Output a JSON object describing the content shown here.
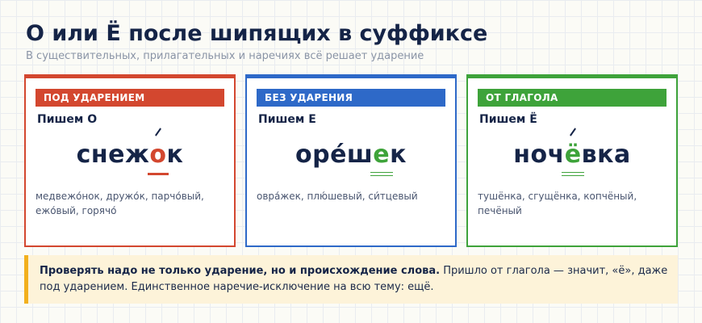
{
  "header": {
    "title": "О или Ё после шипящих в суффиксе",
    "subtitle": "В существительных, прилагательных и наречиях всё решает ударение"
  },
  "cards": [
    {
      "badge": "ПОД УДАРЕНИЕМ",
      "rule": "Пишем О",
      "word_before": "снеж",
      "word_hl": "о",
      "word_after": "к",
      "examples": "медвежо́нок, дружо́к, парчо́вый, ежо́вый, горячо́",
      "color": "#d3472f"
    },
    {
      "badge": "БЕЗ УДАРЕНИЯ",
      "rule": "Пишем Е",
      "word_before": "оре́ш",
      "word_hl": "е",
      "word_after": "к",
      "examples": "овра́жек, плю́шевый, си́тцевый",
      "color": "#2e69c8"
    },
    {
      "badge": "ОТ ГЛАГОЛА",
      "rule": "Пишем Ё",
      "word_before": "ноч",
      "word_hl": "ё",
      "word_after": "вка",
      "examples": "тушёнка, сгущёнка, копчёный, печёный",
      "color": "#3ea33a"
    }
  ],
  "note": {
    "bold": "Проверять надо не только ударение, но и происхождение слова.",
    "text": " Пришло от глагола — значит, «ё», даже под ударением. Единственное наречие-исключение на всю тему: ещё.",
    "accent_color": "#f2b01e"
  }
}
